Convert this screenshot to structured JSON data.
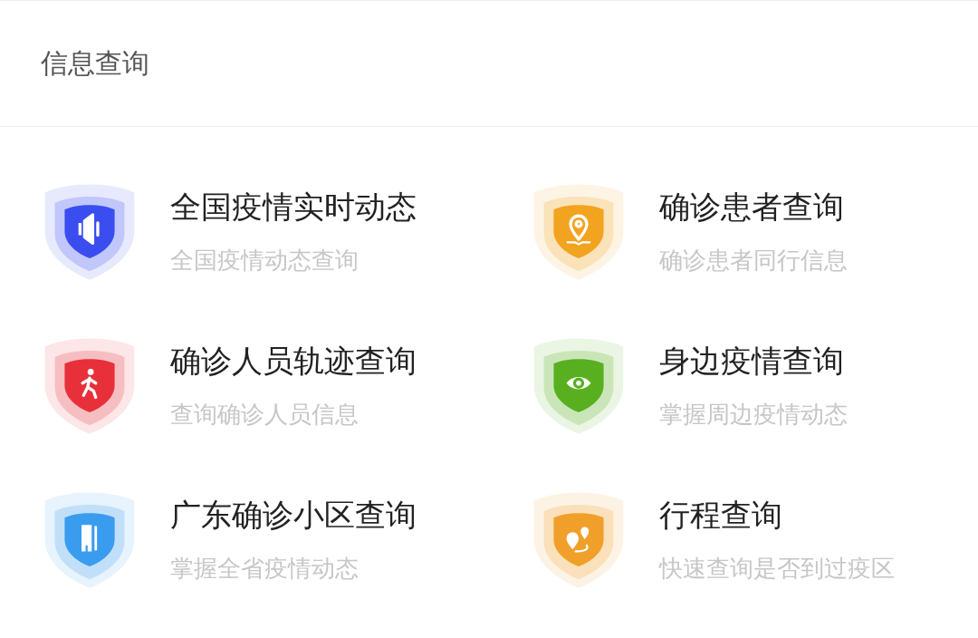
{
  "header": {
    "title": "信息查询"
  },
  "items": [
    {
      "title": "全国疫情实时动态",
      "subtitle": "全国疫情动态查询",
      "kind": "speaker",
      "color": "#3a4ef0"
    },
    {
      "title": "确诊患者查询",
      "subtitle": "确诊患者同行信息",
      "kind": "pin",
      "color": "#f2a31f"
    },
    {
      "title": "确诊人员轨迹查询",
      "subtitle": "查询确诊人员信息",
      "kind": "walker",
      "color": "#e8303a"
    },
    {
      "title": "身边疫情查询",
      "subtitle": "掌握周边疫情动态",
      "kind": "eye",
      "color": "#58b020"
    },
    {
      "title": "广东确诊小区查询",
      "subtitle": "掌握全省疫情动态",
      "kind": "building",
      "color": "#3a9cef"
    },
    {
      "title": "行程查询",
      "subtitle": "快速查询是否到过疫区",
      "kind": "route",
      "color": "#f0a02a"
    }
  ]
}
